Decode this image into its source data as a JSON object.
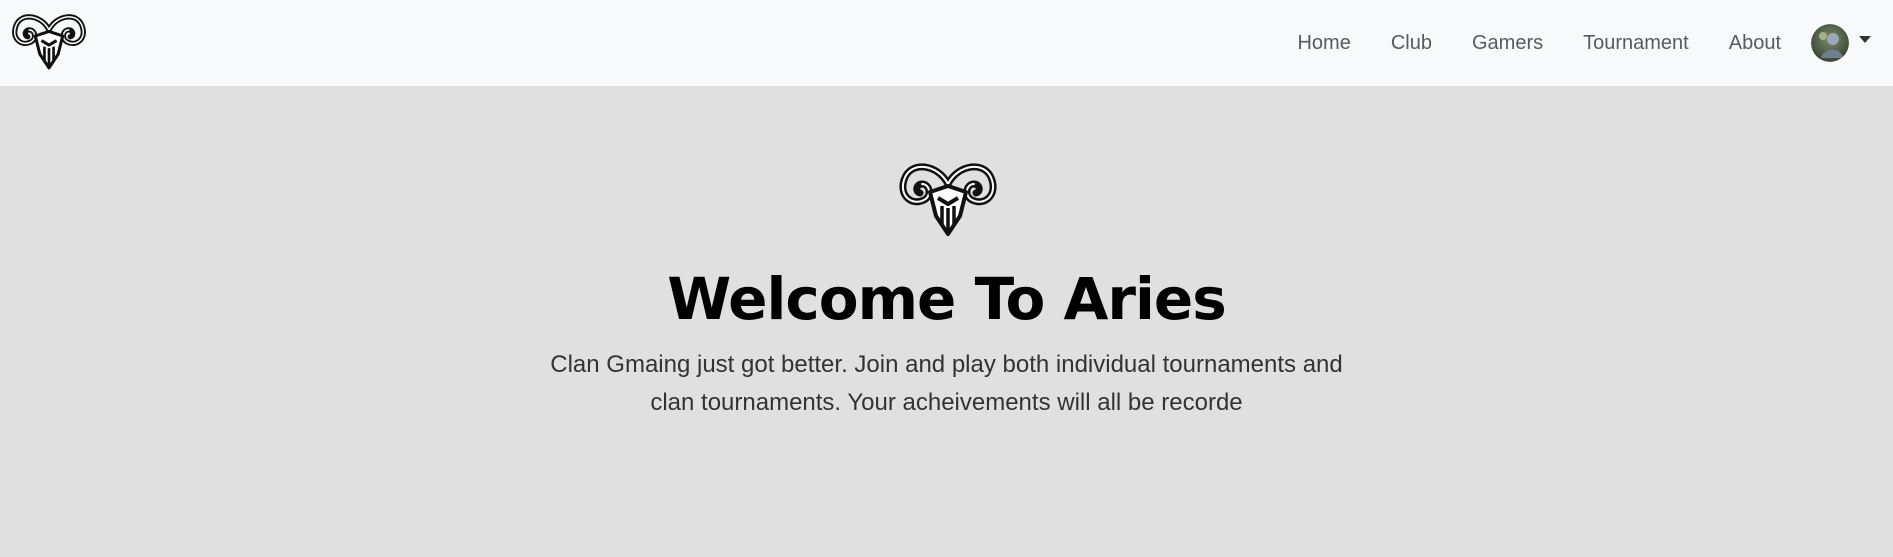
{
  "navbar": {
    "logo_icon": "ram-head-icon",
    "links": [
      {
        "label": "Home"
      },
      {
        "label": "Club"
      },
      {
        "label": "Gamers"
      },
      {
        "label": "Tournament"
      },
      {
        "label": "About"
      }
    ],
    "profile": {
      "avatar_icon": "user-avatar",
      "dropdown_icon": "caret-down-icon"
    }
  },
  "hero": {
    "logo_icon": "ram-head-icon",
    "title": "Welcome To Aries",
    "lead": "Clan Gmaing just got better. Join and play both individual tournaments and clan tournaments. Your acheivements will all be recorde"
  },
  "colors": {
    "navbar_bg": "#f8f9fa",
    "hero_bg": "#e0e0e0",
    "nav_text": "#555b61",
    "title_text": "#000000"
  }
}
